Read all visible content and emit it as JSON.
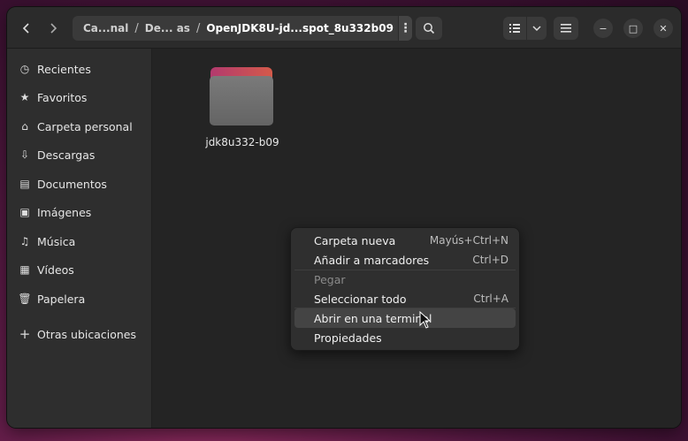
{
  "header": {
    "back_icon": "chevron-left-icon",
    "forward_icon": "chevron-right-icon",
    "path_segments": [
      "Ca...nal",
      "De... as",
      "OpenJDK8U-jd...spot_8u332b09"
    ],
    "path_separator": "/",
    "menu_dots": "⋮",
    "search_icon": "search-icon",
    "view_list_icon": "list-view-icon",
    "view_dropdown_icon": "chevron-down-icon",
    "main_menu_icon": "hamburger-icon",
    "minimize": "−",
    "maximize": "□",
    "close": "✕"
  },
  "sidebar": {
    "items": [
      {
        "label": "Recientes",
        "icon": "◷"
      },
      {
        "label": "Favoritos",
        "icon": "★"
      },
      {
        "label": "Carpeta personal",
        "icon": "⌂"
      },
      {
        "label": "Descargas",
        "icon": "⇩"
      },
      {
        "label": "Documentos",
        "icon": "▤"
      },
      {
        "label": "Imágenes",
        "icon": "▣"
      },
      {
        "label": "Música",
        "icon": "♫"
      },
      {
        "label": "Vídeos",
        "icon": "▦"
      },
      {
        "label": "Papelera",
        "icon": "🗑"
      },
      {
        "label": "Otras ubicaciones",
        "icon": "+"
      }
    ]
  },
  "main": {
    "folder_name": "jdk8u332-b09"
  },
  "context_menu": {
    "items": [
      {
        "label": "Carpeta nueva",
        "accel": "Mayús+Ctrl+N"
      },
      {
        "label": "Añadir a marcadores",
        "accel": "Ctrl+D"
      },
      {
        "label": "Pegar",
        "accel": ""
      },
      {
        "label": "Seleccionar todo",
        "accel": "Ctrl+A"
      },
      {
        "label": "Abrir en una terminal",
        "accel": ""
      },
      {
        "label": "Propiedades",
        "accel": ""
      }
    ]
  },
  "colors": {
    "window_bg": "#242424",
    "sidebar_bg": "#2e2e2e",
    "folder_tab_accent": "#c8485c",
    "menu_bg": "#2f2f2f"
  }
}
